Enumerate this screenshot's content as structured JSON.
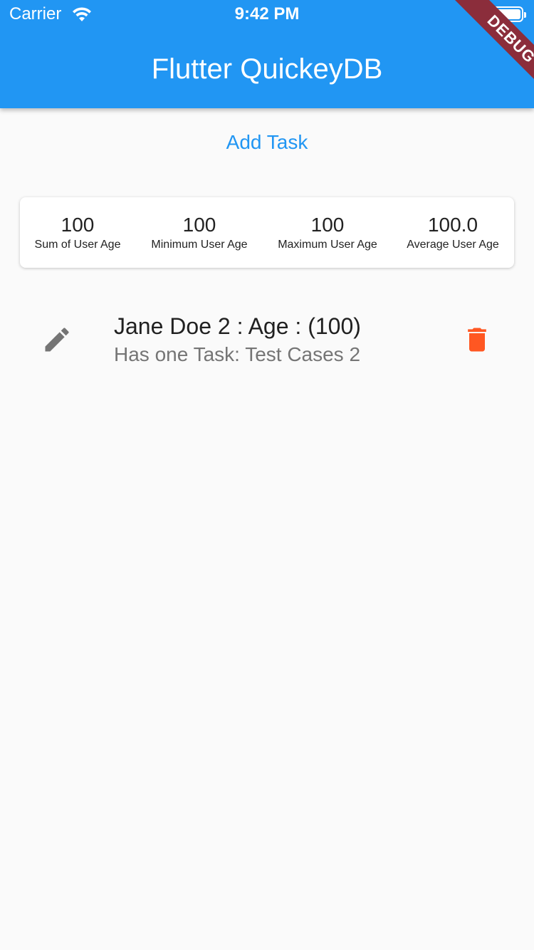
{
  "status_bar": {
    "carrier": "Carrier",
    "time": "9:42 PM"
  },
  "app_bar": {
    "title": "Flutter QuickeyDB",
    "debug_banner": "DEBUG",
    "color": "#2196f3"
  },
  "actions": {
    "add_task": "Add Task"
  },
  "stats": [
    {
      "value": "100",
      "label": "Sum of User Age"
    },
    {
      "value": "100",
      "label": "Minimum User Age"
    },
    {
      "value": "100",
      "label": "Maximum User Age"
    },
    {
      "value": "100.0",
      "label": "Average User Age"
    }
  ],
  "users": [
    {
      "title": "Jane Doe 2 : Age : (100)",
      "subtitle": "Has one Task: Test Cases 2",
      "leading_icon": "edit-icon",
      "trailing_icon": "delete-icon"
    }
  ],
  "colors": {
    "delete": "#ff5722",
    "edit": "#757575",
    "accent": "#2196f3"
  }
}
